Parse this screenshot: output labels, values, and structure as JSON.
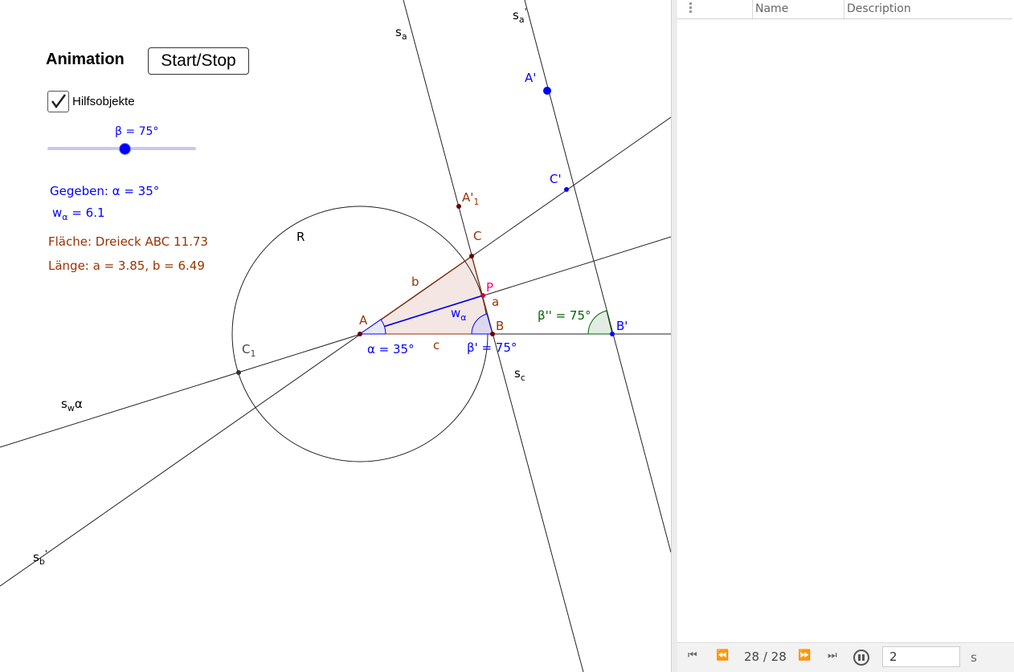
{
  "animation": {
    "title": "Animation",
    "button_label": "Start/Stop"
  },
  "helper": {
    "label": "Hilfsobjekte",
    "checked": true
  },
  "slider": {
    "label": "β = 75°",
    "value_deg": 75
  },
  "info": {
    "given": "Gegeben: α = 35°",
    "w_main": "w",
    "w_sub": "α",
    "w_value": " = 6.1",
    "area": "Fläche: Dreieck ABC 11.73",
    "lengths": "Länge: a = 3.85, b = 6.49"
  },
  "labels": {
    "s_a": "s",
    "s_a_sub": "a",
    "s_a2": "s",
    "s_a2_sub": "a",
    "s_a2_prime": "'",
    "A_prime": "A'",
    "C_prime": "C'",
    "A1": "A'",
    "A1_sub": "1",
    "C": "C",
    "R": "R",
    "b": "b",
    "P": "P",
    "a": "a",
    "w": "w",
    "w_sub": "α",
    "beta_dd": "β'' = 75°",
    "B_prime": "B'",
    "A": "A",
    "B": "B",
    "C1": "C",
    "C1_sub": "1",
    "alpha": "α = 35°",
    "c": "c",
    "beta_p": "β' = 75°",
    "s_c": "s",
    "s_c_sub": "c",
    "s_w": "s",
    "s_w_sub": "w",
    "s_w_alpha": "α",
    "s_b": "s",
    "s_b_sub": "b",
    "s_b_prime": "'"
  },
  "table": {
    "col_name": "Name",
    "col_description": "Description"
  },
  "playbar": {
    "step": "28 / 28",
    "speed": "2",
    "unit": "s"
  },
  "colors": {
    "blue": "#0000ff",
    "brown": "#993300",
    "dark_green": "#006400",
    "pink": "#ff0066"
  }
}
